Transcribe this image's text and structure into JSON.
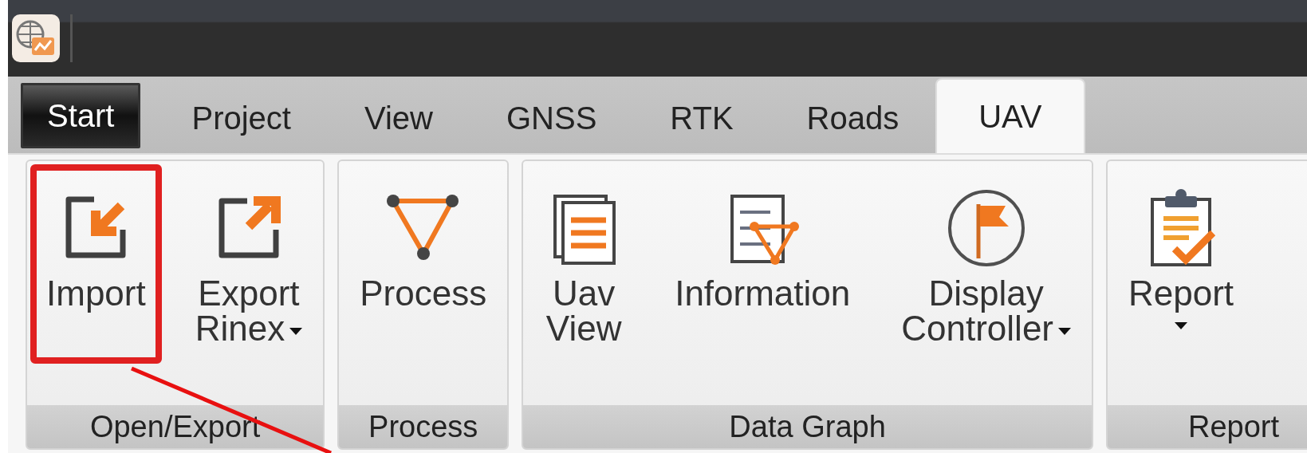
{
  "tabs": [
    {
      "label": "Start",
      "kind": "app",
      "selected": false
    },
    {
      "label": "Project",
      "kind": "tab",
      "selected": false
    },
    {
      "label": "View",
      "kind": "tab",
      "selected": false
    },
    {
      "label": "GNSS",
      "kind": "tab",
      "selected": false
    },
    {
      "label": "RTK",
      "kind": "tab",
      "selected": false
    },
    {
      "label": "Roads",
      "kind": "tab",
      "selected": false
    },
    {
      "label": "UAV",
      "kind": "tab",
      "selected": true
    }
  ],
  "groups": [
    {
      "label": "Open/Export",
      "buttons": [
        {
          "label": "Import",
          "kind": "import",
          "dropdown": false,
          "highlighted": true
        },
        {
          "label": "Export\nRinex",
          "kind": "export",
          "dropdown": true,
          "highlighted": false
        }
      ]
    },
    {
      "label": "Process",
      "buttons": [
        {
          "label": "Process",
          "kind": "triangle",
          "dropdown": false,
          "highlighted": false
        }
      ]
    },
    {
      "label": "Data Graph",
      "buttons": [
        {
          "label": "Uav\nView",
          "kind": "pages",
          "dropdown": false,
          "highlighted": false
        },
        {
          "label": "Information",
          "kind": "graph",
          "dropdown": false,
          "highlighted": false
        },
        {
          "label": "Display\nController",
          "kind": "flag",
          "dropdown": true,
          "highlighted": false
        }
      ]
    },
    {
      "label": "Report",
      "buttons": [
        {
          "label": "Report",
          "kind": "clipboard",
          "dropdown": true,
          "highlighted": false
        }
      ]
    }
  ]
}
